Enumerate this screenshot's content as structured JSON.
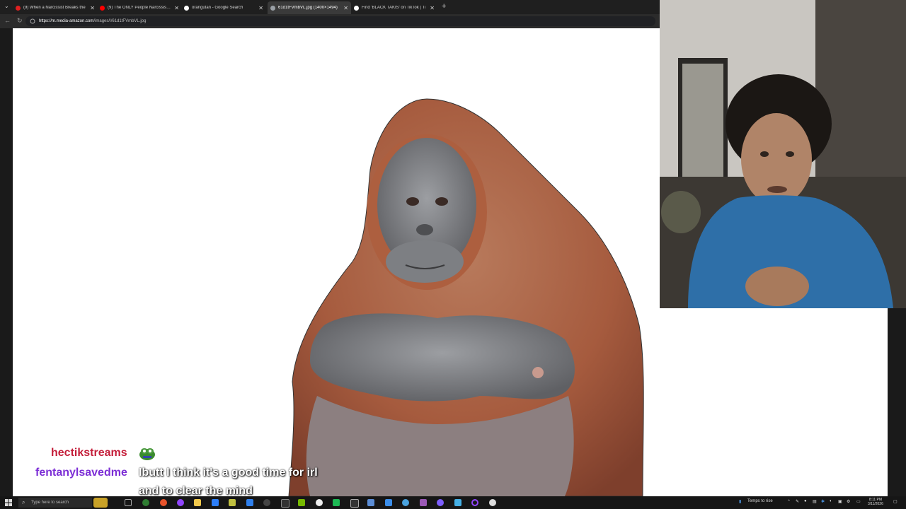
{
  "browser": {
    "tabs": [
      {
        "title": "(9) When a Narcissist Breaks the",
        "favicon_color": "#e02020",
        "active": false
      },
      {
        "title": "(9) The ONLY People Narcissists S",
        "favicon_color": "#ff0000",
        "active": false
      },
      {
        "title": "orangutan - Google Search",
        "favicon_color": "#ffffff",
        "active": false
      },
      {
        "title": "61d1tFVmbVL.jpg (1400×1494)",
        "favicon_color": "#9aa0a6",
        "active": true
      },
      {
        "title": "Find 'BLACK TAKIS' on TikTok | Ti",
        "favicon_color": "#ffffff",
        "active": false
      }
    ],
    "url_host": "https://m.media-amazon.com",
    "url_path": "/images/I/61d1tFVmbVL.jpg"
  },
  "chat": {
    "user1": "hectikstreams",
    "user2": "fentanylsavedme",
    "message_line1": "Ibutt I think it's a good time for irl",
    "message_line2": "and to clear the mind"
  },
  "taskbar": {
    "search_placeholder": "Type here to search",
    "weather": "Temps to rise",
    "time": "8:11 PM",
    "date": "3/11/2026"
  },
  "colors": {
    "chat_user1": "#c41e3a",
    "chat_user2": "#7d2fd6",
    "page_bg": "#ffffff"
  }
}
